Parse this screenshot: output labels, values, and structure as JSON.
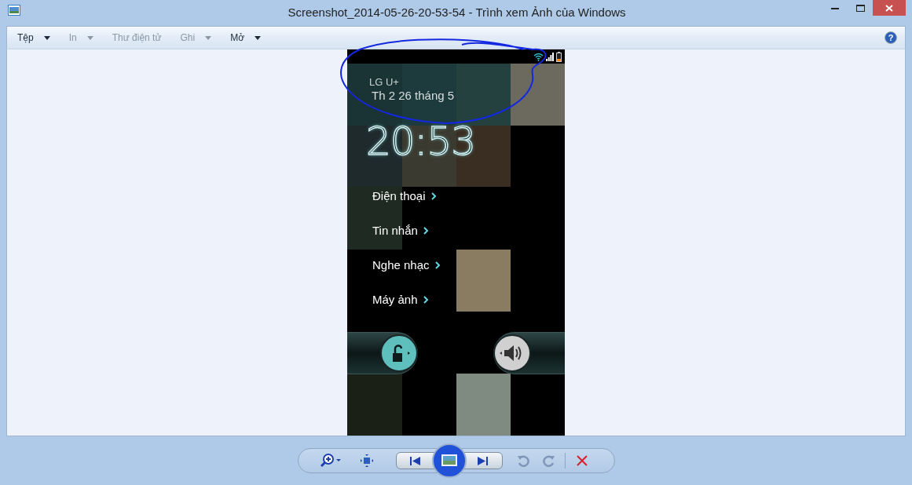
{
  "window": {
    "title": "Screenshot_2014-05-26-20-53-54 - Trình xem Ảnh của Windows",
    "help": "?"
  },
  "menu": [
    {
      "label": "Tệp",
      "disabled": false,
      "dropdown": true
    },
    {
      "label": "In",
      "disabled": true,
      "dropdown": true
    },
    {
      "label": "Thư điện tử",
      "disabled": true,
      "dropdown": false
    },
    {
      "label": "Ghi",
      "disabled": true,
      "dropdown": true
    },
    {
      "label": "Mở",
      "disabled": false,
      "dropdown": true
    }
  ],
  "phone": {
    "carrier": "LG U+",
    "date": "Th 2 26 tháng 5",
    "time": "20:53",
    "shortcuts": [
      {
        "label": "Điện thoại"
      },
      {
        "label": "Tin nhắn"
      },
      {
        "label": "Nghe nhạc"
      },
      {
        "label": "Máy ảnh"
      }
    ]
  }
}
